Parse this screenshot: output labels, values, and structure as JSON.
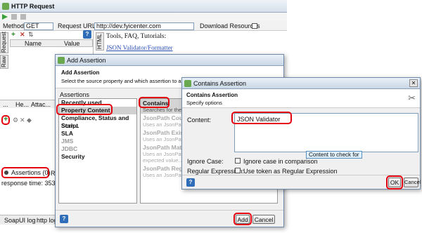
{
  "window": {
    "title": "HTTP Request"
  },
  "request_bar": {
    "method_label": "Method",
    "method_value": "GET",
    "url_label": "Request URL:",
    "url_value": "http://dev.fyicenter.com",
    "download_label": "Download Resources"
  },
  "left_panel": {
    "vtab_request": "Request",
    "vtab_raw": "Raw",
    "col_name": "Name",
    "col_value": "Value",
    "bottom_tabs": [
      "...",
      "He...",
      "Attac..."
    ],
    "assertions_tab": "Assertions (0)",
    "assertions_suffix": "Re",
    "response_time": "response time: 353ms",
    "log_tabs": [
      "SoapUI log",
      "http log"
    ]
  },
  "right_panel": {
    "tools_text": "Tools, FAQ, Tutorials:",
    "link_text": "JSON Validator/Formatter",
    "vtab_html": "HTML"
  },
  "add_assertion_dialog": {
    "title": "Add Assertion",
    "header_title": "Add Assertion",
    "header_desc": "Select the source property and which assertion to apply below",
    "assertions_label": "Assertions",
    "categories": [
      "Recently used",
      "Property Content",
      "Compliance, Status and Stan...",
      "Script",
      "SLA",
      "JMS",
      "JDBC",
      "Security"
    ],
    "selected_category": "Property Content",
    "types": [
      {
        "name": "Contains",
        "desc": "Searches for the ... property value."
      },
      {
        "name": "JsonPath Count",
        "desc": "Uses an JsonPath ... an element. Appl..."
      },
      {
        "name": "JsonPath Existe...",
        "desc": "Uses an JsonPath ... target property"
      },
      {
        "name": "JsonPath Match",
        "desc": "Uses an JsonPath ... compares the result to an expected value. Applicable to"
      },
      {
        "name": "JsonPath RegEx Match",
        "desc": "Uses an JsonPath expression to select content from the"
      }
    ],
    "add_label": "Add",
    "cancel_label": "Cancel"
  },
  "contains_dialog": {
    "title": "Contains Assertion",
    "header_title": "Contains Assertion",
    "header_desc": "Specify options",
    "content_label": "Content:",
    "content_value": "JSON Validator",
    "tooltip": "Content to check for",
    "ignore_case_label": "Ignore Case:",
    "ignore_case_option": "Ignore case in comparison",
    "regex_label": "Regular Expression:",
    "regex_option": "Use token as Regular Expression",
    "ok_label": "OK",
    "cancel_label": "Cancel"
  },
  "icons": {
    "help": "help-icon",
    "add": "plus-icon",
    "remove": "delete-icon"
  },
  "colors": {
    "highlight_red": "#e3000f",
    "link_blue": "#2a4fb5"
  }
}
